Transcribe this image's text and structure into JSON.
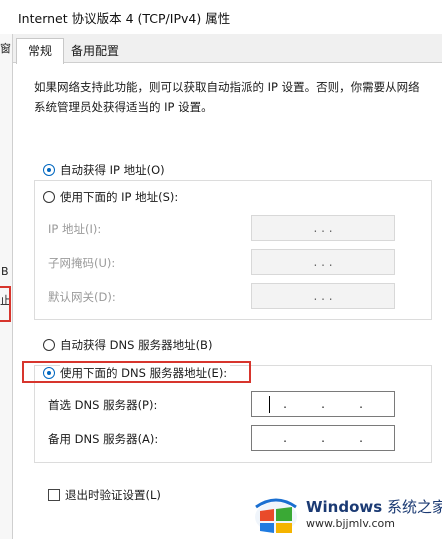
{
  "window": {
    "title": "Internet 协议版本 4 (TCP/IPv4) 属性"
  },
  "tabs": [
    {
      "label": "常规",
      "active": true
    },
    {
      "label": "备用配置",
      "active": false
    }
  ],
  "description": "如果网络支持此功能，则可以获取自动指派的 IP 设置。否则，你需要从网络系统管理员处获得适当的 IP 设置。",
  "ip_section": {
    "auto_label": "自动获得 IP 地址(O)",
    "auto_selected": true,
    "manual_label": "使用下面的 IP 地址(S):",
    "fields": [
      {
        "label": "IP 地址(I):",
        "value": ".     .     ."
      },
      {
        "label": "子网掩码(U):",
        "value": ".     .     ."
      },
      {
        "label": "默认网关(D):",
        "value": ".     .     ."
      }
    ]
  },
  "dns_section": {
    "auto_label": "自动获得 DNS 服务器地址(B)",
    "manual_label": "使用下面的 DNS 服务器地址(E):",
    "manual_selected": true,
    "fields": [
      {
        "label": "首选 DNS 服务器(P):",
        "value": ""
      },
      {
        "label": "备用 DNS 服务器(A):",
        "value": ""
      }
    ]
  },
  "validate_on_exit": {
    "label": "退出时验证设置(L)",
    "checked": false
  },
  "background_window": {
    "chars": [
      "窗",
      "B",
      "止"
    ]
  },
  "watermark": {
    "brand": "Windows",
    "brand_cn": "系统之家",
    "url": "www.bjjmlv.com"
  },
  "colors": {
    "highlight": "#d7352d",
    "accent": "#0067c0"
  }
}
